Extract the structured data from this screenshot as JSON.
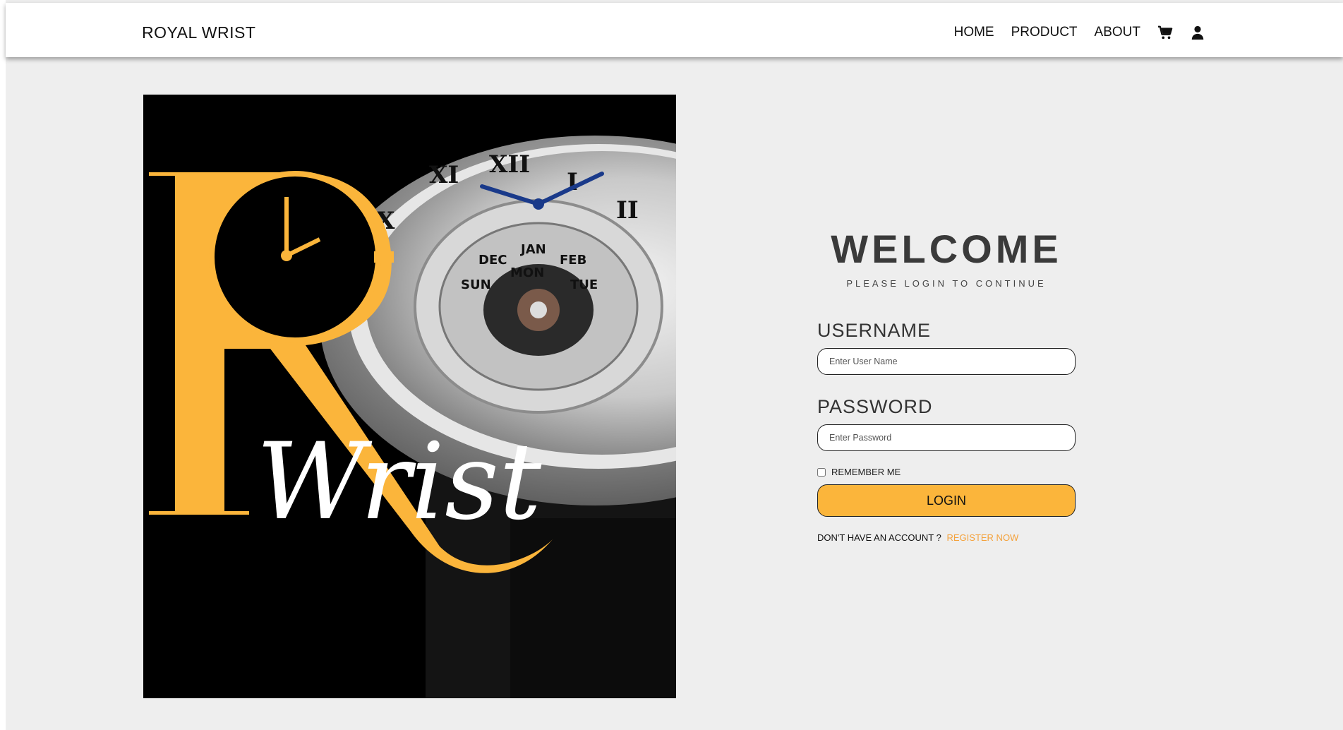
{
  "brand": "ROYAL WRIST",
  "nav": {
    "items": [
      "HOME",
      "PRODUCT",
      "ABOUT"
    ],
    "cart_icon": "cart-icon",
    "user_icon": "user-icon"
  },
  "hero": {
    "logo_text": "Wrist",
    "colors": {
      "accent": "#fbb53b",
      "background": "#000000"
    }
  },
  "login": {
    "title": "WELCOME",
    "subtitle": "PLEASE LOGIN TO CONTINUE",
    "username_label": "USERNAME",
    "username_placeholder": "Enter User Name",
    "password_label": "PASSWORD",
    "password_placeholder": "Enter Password",
    "remember_label": "REMEMBER ME",
    "button_label": "LOGIN",
    "no_account_text": "DON'T HAVE AN ACCOUNT ?",
    "register_label": "REGISTER NOW"
  },
  "colors": {
    "page_bg": "#eeeeee",
    "accent": "#fbb53b",
    "link": "#f4a13a"
  }
}
